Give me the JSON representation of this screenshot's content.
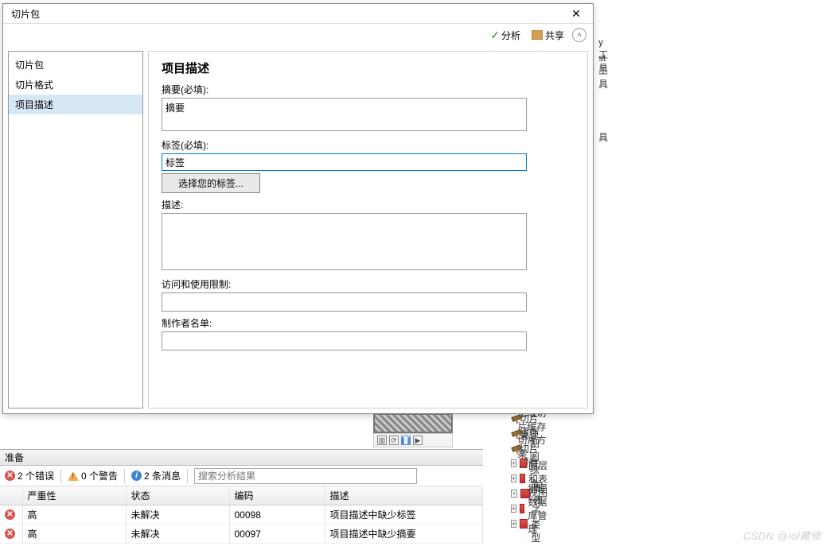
{
  "dialog": {
    "title": "切片包",
    "toolbar": {
      "analyze": "分析",
      "share": "共享"
    },
    "sidebar": {
      "items": [
        {
          "label": "切片包"
        },
        {
          "label": "切片格式"
        },
        {
          "label": "项目描述"
        }
      ],
      "selected_index": 2
    },
    "form": {
      "heading": "项目描述",
      "summary_label": "摘要(必填):",
      "summary_value": "摘要",
      "tags_label": "标签(必填):",
      "tags_value": "标签",
      "choose_tags_button": "选择您的标签...",
      "desc_label": "描述:",
      "desc_value": "",
      "access_label": "访问和使用限制:",
      "access_value": "",
      "author_label": "制作者名单:",
      "author_value": ""
    }
  },
  "right_tree": {
    "tools_suffix_1": "y 工具",
    "tools_suffix_2": "st 工具",
    "tools_suffix_3": "具",
    "hammer_items": [
      "导出切片缓存",
      "生成切片缓存切片方案",
      "管理切片缓存"
    ],
    "box_items": [
      "制图综合",
      "图层和表视图",
      "图表",
      "地理数据库管理",
      "子类型"
    ]
  },
  "bottom": {
    "header": "准备",
    "filters": {
      "errors": "2 个错误",
      "warnings": "0 个警告",
      "messages": "2 条消息"
    },
    "search_placeholder": "搜索分析结果",
    "columns": {
      "severity": "严重性",
      "status": "状态",
      "code": "编码",
      "desc": "描述"
    },
    "rows": [
      {
        "severity": "高",
        "status": "未解决",
        "code": "00098",
        "desc": "项目描述中缺少标签"
      },
      {
        "severity": "高",
        "status": "未解决",
        "code": "00097",
        "desc": "项目描述中缺少摘要"
      }
    ]
  },
  "watermark": "CSDN @lol藏修"
}
